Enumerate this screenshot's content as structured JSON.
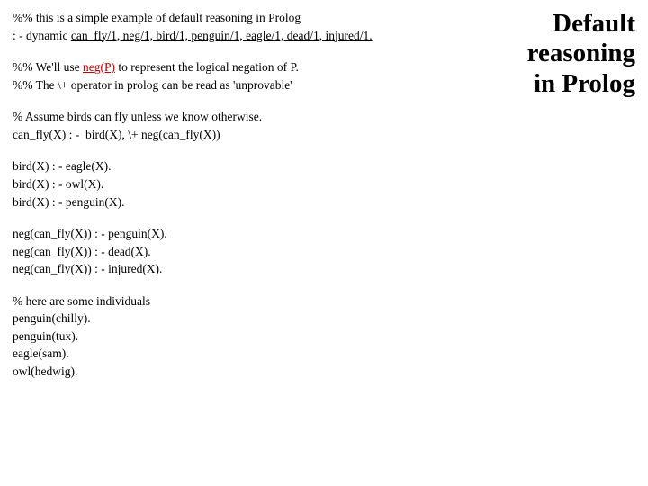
{
  "title_l1": "Default",
  "title_l2": "reasoning",
  "title_l3": "in Prolog",
  "b1_l1": "%% this is a simple example of default reasoning in Prolog",
  "b1_l2a": ": - dynamic ",
  "b1_l2b": "can_fly/1, neg/1, bird/1, penguin/1, eagle/1, dead/1, injured/1.",
  "b2_l1a": "%% We'll use ",
  "b2_l1b": "neg(P)",
  "b2_l1c": " to represent the logical negation of P.",
  "b2_l2": "%% The \\+ operator in prolog can be read as 'unprovable'",
  "b3_l1": "% Assume birds can fly unless we know otherwise.",
  "b3_l2": "can_fly(X) : -  bird(X), \\+ neg(can_fly(X))",
  "b4_l1": "bird(X) : - eagle(X).",
  "b4_l2": "bird(X) : - owl(X).",
  "b4_l3": "bird(X) : - penguin(X).",
  "b5_l1": "neg(can_fly(X)) : - penguin(X).",
  "b5_l2": "neg(can_fly(X)) : - dead(X).",
  "b5_l3": "neg(can_fly(X)) : - injured(X).",
  "b6_l1": "% here are some individuals",
  "b6_l2": "penguin(chilly).",
  "b6_l3": "penguin(tux).",
  "b6_l4": "eagle(sam).",
  "b6_l5": "owl(hedwig)."
}
